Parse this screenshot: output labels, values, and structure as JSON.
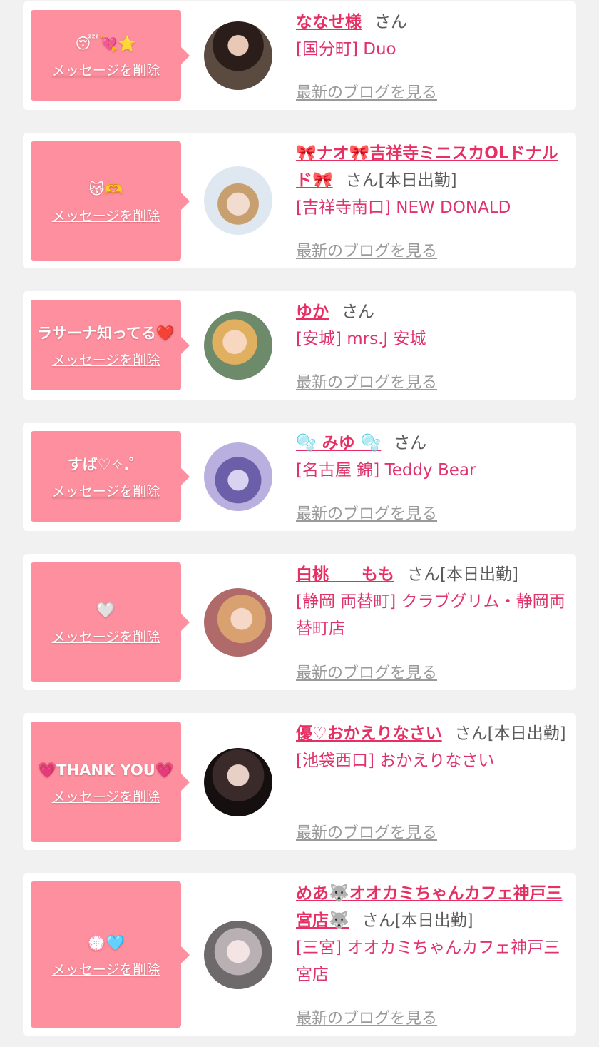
{
  "colors": {
    "page_bg": "#f1f1f1",
    "card_bg": "#ffffff",
    "bubble_pink": "#fd8f9e",
    "name_pink": "#e63064",
    "shop_pink": "#e0336b",
    "link_gray": "#9a9a9a"
  },
  "delete_label": "メッセージを削除",
  "honorific": "さん",
  "blog_label": "最新のブログを見る",
  "cards": [
    {
      "message": "😴💘⭐",
      "name": "ななせ様",
      "tag": "",
      "shop": "[国分町] Duo"
    },
    {
      "message": "😽🫶",
      "name": "🎀ナオ🎀吉祥寺ミニスカOLドナルド🎀",
      "tag": "[本日出勤]",
      "shop": "[吉祥寺南口] NEW DONALD"
    },
    {
      "message": "ラサーナ知ってる❤️",
      "name": "ゆか",
      "tag": "",
      "shop": "[安城] mrs.J 安城"
    },
    {
      "message": "すば♡✧.゜",
      "name": "🫧 みゆ 🫧",
      "tag": "",
      "shop": "[名古屋 錦] Teddy Bear"
    },
    {
      "message": "🤍",
      "name": "白桃　　もも",
      "tag": "[本日出勤]",
      "shop": "[静岡 両替町] クラブグリム・静岡両替町店"
    },
    {
      "message": "💗THANK YOU💗",
      "name": "優♡おかえりなさい",
      "tag": "[本日出勤]",
      "shop": "[池袋西口] おかえりなさい"
    },
    {
      "message": "💮🩵",
      "name": "めあ🐺オオカミちゃんカフェ神戸三宮店🐺",
      "tag": "[本日出勤]",
      "shop": "[三宮] オオカミちゃんカフェ神戸三宮店"
    }
  ]
}
